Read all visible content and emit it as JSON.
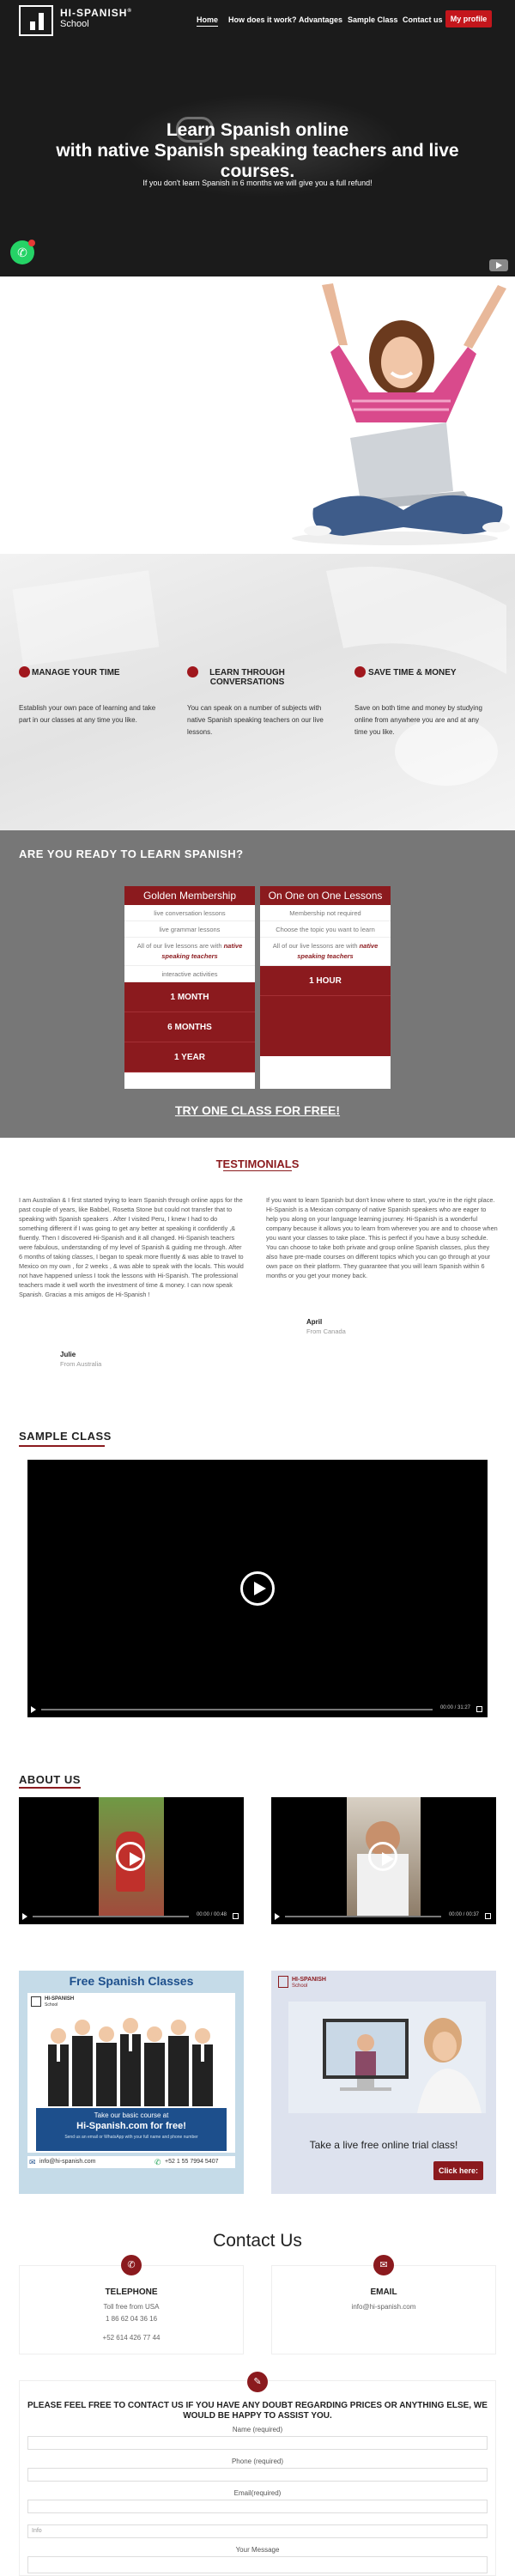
{
  "brand": {
    "name": "HI-SPANISH",
    "tm": "®",
    "sub": "School"
  },
  "nav": {
    "items": [
      {
        "label": "Home"
      },
      {
        "label": "How does it work?"
      },
      {
        "label": "Advantages"
      },
      {
        "label": "Sample Class"
      },
      {
        "label": "Contact us"
      }
    ],
    "profile": "My profile"
  },
  "hero": {
    "title": "Learn Spanish online\nwith native Spanish speaking teachers and live courses.",
    "subtitle": "If you don't learn Spanish in 6 months we will give you a full refund!"
  },
  "features": [
    {
      "title": "MANAGE YOUR TIME",
      "text": "Establish your own pace of learning and take part in our classes at any time you like."
    },
    {
      "title": "LEARN THROUGH CONVERSATIONS",
      "text": "You can speak on a number of subjects with native Spanish speaking teachers on our live lessons."
    },
    {
      "title": "SAVE TIME & MONEY",
      "text": "Save on both time and money by studying online from anywhere you are and at any time you like."
    }
  ],
  "pricing": {
    "title": "ARE YOU READY TO LEARN SPANISH?",
    "plans": [
      {
        "name": "Golden Membership",
        "features": [
          "live conversation lessons",
          "live grammar lessons",
          "All of our live lessons are with ",
          "interactive activities"
        ],
        "highlight": "native speaking teachers",
        "options": [
          "1 MONTH",
          "6 MONTHS",
          "1 YEAR"
        ]
      },
      {
        "name": "On One on One Lessons",
        "features": [
          "Membership not required",
          "Choose the topic you want to learn",
          "All of our live lessons are with "
        ],
        "highlight": "native speaking teachers",
        "options": [
          "1 HOUR"
        ]
      }
    ],
    "cta": "TRY ONE CLASS FOR FREE!"
  },
  "testimonials": {
    "title": "TESTIMONIALS",
    "items": [
      {
        "text": "I am Australian & I first started trying to learn Spanish through online apps for the past couple of years, like Babbel, Rosetta Stone but could not transfer that to speaking with Spanish speakers . After I visited Peru, I knew I had to do something different if I was going to get any better at speaking it confidently ,& fluently. Then I discovered Hi-Spanish and it all changed. Hi-Spanish teachers were fabulous, understanding of my level of Spanish & guiding me through. After 6 months of taking classes, I began to speak more fluently & was able to travel to Mexico on my own , for 2 weeks , & was able to speak with the locals. This would not have happened unless I took the lessons with Hi-Spanish. The professional teachers made it well worth the investment of time & money. I can now speak Spanish. Gracias a mis amigos de Hi-Spanish !",
        "name": "Julie",
        "from": "From Australia"
      },
      {
        "text": "If you want to learn Spanish but don't know where to start, you're in the right place. Hi-Spanish is a Mexican company of native Spanish speakers who are eager to help you along on your language learning journey. Hi-Spanish is a wonderful company because it allows you to learn from wherever you are and to choose when you want your classes to take place. This is perfect if you have a busy schedule. You can choose to take both private and group online Spanish classes, plus they also have pre-made courses on different topics which you can go through at your own pace on their platform. They guarantee that you will learn Spanish within 6 months or you get your money back.",
        "name": "April",
        "from": "From Canada"
      }
    ]
  },
  "sample": {
    "title": "SAMPLE CLASS",
    "time": "00:00 / 31:27"
  },
  "about": {
    "title": "ABOUT US",
    "time1": "00:00 / 00:48",
    "time2": "00:00 / 00:37"
  },
  "promo1": {
    "title": "Free Spanish Classes",
    "logo": "HI-SPANISH",
    "logo_sub": "School",
    "line1": "Take our basic course at",
    "line2": "Hi-Spanish.com for free!",
    "line3": "Send us an email or WhatsApp with your full name and phone number",
    "email": "info@hi-spanish.com",
    "phone": "+52 1 55 7994 5407"
  },
  "promo2": {
    "logo": "HI-SPANISH",
    "logo_sub": "School",
    "caption": "Take a live free online trial class!",
    "button": "Click here:"
  },
  "contact": {
    "title": "Contact Us",
    "phone": {
      "heading": "TELEPHONE",
      "line1": "Toll free from USA",
      "line2": "1 86 62 04 36 16",
      "line3": "+52 614 426 77 44"
    },
    "email": {
      "heading": "EMAIL",
      "value": "info@hi-spanish.com"
    },
    "form": {
      "heading": "PLEASE FEEL FREE TO CONTACT US IF YOU HAVE ANY DOUBT REGARDING PRICES OR ANYTHING ELSE, WE WOULD BE HAPPY TO ASSIST YOU.",
      "name_label": "Name (required)",
      "phone_label": "Phone (required)",
      "email_label": "Email(required)",
      "info_placeholder": "Info",
      "message_label": "Your Message"
    }
  },
  "colors": {
    "brand_red": "#8b1a1e",
    "nav_red": "#c4161c",
    "hero_bg": "#1b1b1b",
    "pricing_bg": "#777777"
  }
}
